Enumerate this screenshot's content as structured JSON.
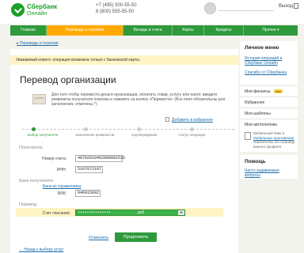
{
  "header": {
    "logo_line1": "Сбербанк",
    "logo_line2": "Онлайн",
    "phone1": "+7 (495) 500-55-50",
    "phone2": "8 (800) 555-55-50",
    "exit_label": "Выход"
  },
  "nav": {
    "items": [
      {
        "label": "Главная"
      },
      {
        "label": "Переводы и платежи"
      },
      {
        "label": "Вклады и счета"
      },
      {
        "label": "Карты"
      },
      {
        "label": "Кредиты"
      },
      {
        "label": "Прочее ▾"
      }
    ]
  },
  "breadcrumb": {
    "label": "Переводы и платежи"
  },
  "notice": "Уважаемый клиент, операция возможна только с банковской карты.",
  "form": {
    "title": "Перевод организации",
    "description": "Для того чтобы перевести деньги организации, оплатить товар, услугу или налог, введите реквизиты получателя платежа и нажмите на кнопку «Перевести» (Все поля обязательны для заполнения, отмечены *)",
    "favorite_link": "Добавить в избранное",
    "steps": [
      {
        "label": "выбор получателя",
        "done": true
      },
      {
        "label": "заполнение реквизитов",
        "done": false
      },
      {
        "label": "подтверждение",
        "done": false
      },
      {
        "label": "статус операции",
        "done": false
      }
    ],
    "recipient_section": "Получатель",
    "account_label": "Номер счета:",
    "account_value": "40702810462090001515",
    "inn_label": "ИНН:",
    "inn_value": "5167072187",
    "bank_section": "Банк получателя",
    "bank_link": "Банк из справочника",
    "bik_label": "БИК:",
    "bik_value": "046015602",
    "transfer_section": "Перевод",
    "debit_label": "Счет списания:",
    "debit_mask": "•••••••••••••••",
    "debit_currency": "руб",
    "cancel_label": "Отменить",
    "continue_label": "Продолжить",
    "back_label": "← Назад к выбору услуг"
  },
  "sidebar": {
    "menu_title": "Личное меню",
    "history_link": "История операций в Сбербанк Онлайн",
    "thanks_link": "Спасибо от Сбербанка",
    "items": [
      {
        "label": "Мои финансы",
        "badge": "new"
      },
      {
        "label": "Избранное"
      },
      {
        "label": "Мои шаблоны"
      },
      {
        "label": "Мои автоплатежи"
      }
    ],
    "promo_text_before": "Мобильный банк и ",
    "promo_link": "Мобильные приложения",
    "promo_text_after": " перенесены на страницу вашего профиля",
    "help_title": "Помощь",
    "help_link": "Часто задаваемые вопросы"
  },
  "colors": {
    "brand_green": "#2f9a3c",
    "active_tab": "#ffaa00",
    "notice_bg": "#fef4c4",
    "link": "#1d6dab"
  }
}
